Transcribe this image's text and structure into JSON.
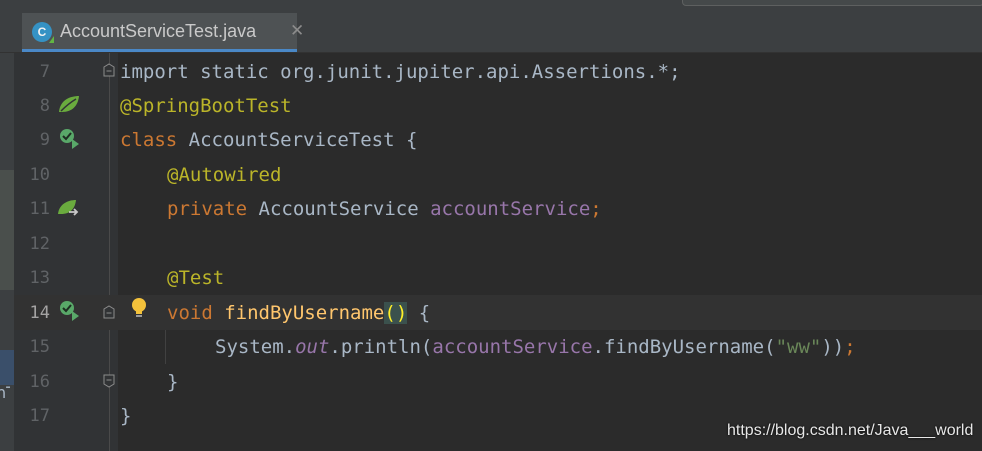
{
  "tab": {
    "title": "AccountServiceTest.java",
    "close_glyph": "✕",
    "icon_letter": "C"
  },
  "line_numbers": [
    "7",
    "8",
    "9",
    "10",
    "11",
    "12",
    "13",
    "14",
    "15",
    "16",
    "17"
  ],
  "current_line": "14",
  "code": {
    "l7": "import static org.junit.jupiter.api.Assertions.*;",
    "l8_annotation": "@SpringBootTest",
    "l9_kw": "class",
    "l9_name": " AccountServiceTest {",
    "l10_annotation": "@Autowired",
    "l11_kw": "private",
    "l11_type": " AccountService ",
    "l11_field": "accountService",
    "l11_semi": ";",
    "l13_annotation": "@Test",
    "l14_kw": "void",
    "l14_sp": " ",
    "l14_method": "findByUsername",
    "l14_parens": "()",
    "l14_brace": " {",
    "l15_system": "System.",
    "l15_out": "out",
    "l15_println": ".println",
    "l15_paren_open": "(",
    "l15_field": "accountService",
    "l15_call": ".findByUsername(",
    "l15_string": "\"ww\"",
    "l15_close": "))",
    "l15_semi": ";",
    "l16_brace": "}",
    "l17_brace": "}"
  },
  "left_strip_fragment": "nT",
  "watermark": "https://blog.csdn.net/Java___world",
  "colors": {
    "keyword": "#cc7832",
    "annotation": "#bbb529",
    "field": "#9876aa",
    "method": "#ffc66d",
    "string": "#6a8759",
    "text": "#a9b7c6",
    "background": "#2b2b2b",
    "gutter": "#313335"
  },
  "gutter_icons": {
    "line8": "spring-leaf-icon",
    "line9": "run-test-icon",
    "line11": "autowired-navigate-icon",
    "line14_run": "run-test-icon",
    "line14_hint": "lightbulb-icon"
  }
}
